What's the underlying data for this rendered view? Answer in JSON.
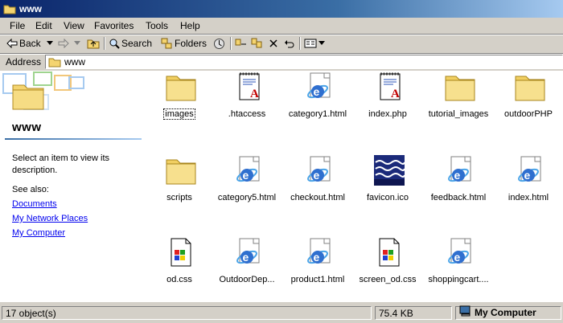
{
  "window": {
    "title": "www"
  },
  "menu": [
    "File",
    "Edit",
    "View",
    "Favorites",
    "Tools",
    "Help"
  ],
  "toolbar": {
    "back": "Back",
    "search": "Search",
    "folders": "Folders"
  },
  "address": {
    "label": "Address",
    "value": "www"
  },
  "leftpane": {
    "title": "www",
    "description": "Select an item to view its description.",
    "see_also": "See also:",
    "links": [
      "Documents",
      "My Network Places",
      "My Computer"
    ]
  },
  "files": [
    {
      "name": "images",
      "type": "folder-icon",
      "selected": true
    },
    {
      "name": ".htaccess",
      "type": "text-document-icon"
    },
    {
      "name": "category1.html",
      "type": "ie-html-icon"
    },
    {
      "name": "index.php",
      "type": "text-document-icon"
    },
    {
      "name": "tutorial_images",
      "type": "folder-icon"
    },
    {
      "name": "outdoorPHP",
      "type": "folder-icon"
    },
    {
      "name": "scripts",
      "type": "folder-icon"
    },
    {
      "name": "category5.html",
      "type": "ie-html-icon"
    },
    {
      "name": "checkout.html",
      "type": "ie-html-icon"
    },
    {
      "name": "favicon.ico",
      "type": "favicon-image-icon"
    },
    {
      "name": "feedback.html",
      "type": "ie-html-icon"
    },
    {
      "name": "index.html",
      "type": "ie-html-icon"
    },
    {
      "name": "od.css",
      "type": "css-document-icon"
    },
    {
      "name": "OutdoorDep...",
      "type": "ie-html-icon"
    },
    {
      "name": "product1.html",
      "type": "ie-html-icon"
    },
    {
      "name": "screen_od.css",
      "type": "css-document-icon"
    },
    {
      "name": "shoppingcart....",
      "type": "ie-html-icon"
    }
  ],
  "status": {
    "objects": "17 object(s)",
    "size": "75.4 KB",
    "zone": "My Computer"
  },
  "colors": {
    "title_gradient_start": "#0a246a",
    "title_gradient_end": "#a6caf0",
    "link": "#0000ee",
    "chrome": "#d4d0c8"
  }
}
